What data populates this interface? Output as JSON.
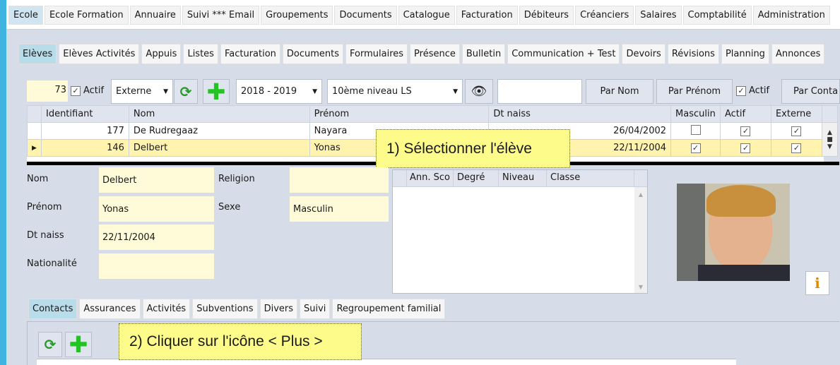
{
  "top_menu": [
    "Ecole",
    "Ecole Formation",
    "Annuaire",
    "Suivi *** Email",
    "Groupements",
    "Documents",
    "Catalogue",
    "Facturation",
    "Débiteurs",
    "Créanciers",
    "Salaires",
    "Comptabilité",
    "Administration"
  ],
  "sub_tabs": [
    "Elèves",
    "Elèves Activités",
    "Appuis",
    "Listes",
    "Facturation",
    "Documents",
    "Formulaires",
    "Présence",
    "Bulletin",
    "Communication + Test",
    "Devoirs",
    "Révisions",
    "Planning",
    "Annonces"
  ],
  "toolbar": {
    "count": "73",
    "actif_label": "Actif",
    "type_select": "Externe",
    "year_select": "2018 - 2019",
    "class_select": "10ème niveau LS",
    "search_value": "",
    "par_nom": "Par Nom",
    "par_prenom": "Par Prénom",
    "actif2_label": "Actif",
    "par_contact": "Par Conta"
  },
  "grid": {
    "headers": [
      "Identifiant",
      "Nom",
      "Prénom",
      "Dt naiss",
      "Masculin",
      "Actif",
      "Externe"
    ],
    "rows": [
      {
        "id": "177",
        "nom": "De Rudregaaz",
        "prenom": "Nayara",
        "dt": "26/04/2002",
        "masculin": false,
        "actif": true,
        "externe": true
      },
      {
        "id": "146",
        "nom": "Delbert",
        "prenom": "Yonas",
        "dt": "22/11/2004",
        "masculin": true,
        "actif": true,
        "externe": true
      }
    ]
  },
  "details": {
    "nom_label": "Nom",
    "nom": "Delbert",
    "prenom_label": "Prénom",
    "prenom": "Yonas",
    "dtnaiss_label": "Dt naiss",
    "dtnaiss": "22/11/2004",
    "nationalite_label": "Nationalité",
    "nationalite": "",
    "religion_label": "Religion",
    "religion": "",
    "sexe_label": "Sexe",
    "sexe": "Masculin"
  },
  "classes_grid": {
    "headers": [
      "Ann. Sco",
      "Degré",
      "Niveau",
      "Classe"
    ]
  },
  "bottom_tabs": [
    "Contacts",
    "Assurances",
    "Activités",
    "Subventions",
    "Divers",
    "Suivi",
    "Regroupement familial"
  ],
  "callouts": {
    "one": "1) Sélectionner l'élève",
    "two": "2) Cliquer sur l'icône < Plus >"
  },
  "colors": {
    "accent": "#3fb4e0",
    "selected_row": "#fff3ad",
    "callout": "#fdfc8a"
  }
}
